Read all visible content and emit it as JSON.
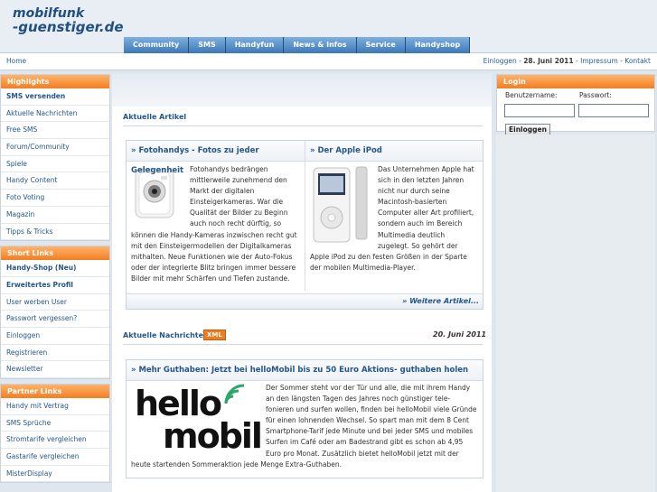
{
  "logo": {
    "line1": "mobilfunk",
    "line2": "-guenstiger.de"
  },
  "nav": [
    "Community",
    "SMS",
    "Handyfun",
    "News & Infos",
    "Service",
    "Handyshop"
  ],
  "breadcrumb": "Home",
  "toplinks": {
    "login": "Einloggen",
    "sep1": " - ",
    "date": "28. Juni 2011",
    "sep2": " - ",
    "impressum": "Impressum",
    "sep3": " - ",
    "kontakt": "Kontakt"
  },
  "sidebar": [
    {
      "title": "Highlights",
      "items": [
        {
          "label": "SMS versenden",
          "bold": true
        },
        {
          "label": "Aktuelle Nachrichten"
        },
        {
          "label": "Free SMS"
        },
        {
          "label": "Forum/Community"
        },
        {
          "label": "Spiele"
        },
        {
          "label": "Handy Content"
        },
        {
          "label": "Foto Voting"
        },
        {
          "label": "Magazin"
        },
        {
          "label": "Tipps & Tricks"
        }
      ]
    },
    {
      "title": "Short Links",
      "items": [
        {
          "label": "Handy-Shop (Neu)",
          "bold": true
        },
        {
          "label": "Erweitertes Profil",
          "bold": true
        },
        {
          "label": "User werben User"
        },
        {
          "label": "Passwort vergessen?"
        },
        {
          "label": "Einloggen"
        },
        {
          "label": "Registrieren"
        },
        {
          "label": "Newsletter"
        }
      ]
    },
    {
      "title": "Partner Links",
      "items": [
        {
          "label": "Handy mit Vertrag"
        },
        {
          "label": "SMS Sprüche"
        },
        {
          "label": "Stromtarife vergleichen"
        },
        {
          "label": "Gastarife vergleichen"
        },
        {
          "label": "MisterDisplay"
        }
      ]
    }
  ],
  "articles": {
    "title": "Aktuelle Artikel",
    "left": {
      "headline": "» Fotohandys - Fotos zu jeder Gelegenheit",
      "text": "Fotohandys bedrängen mittlerweile zunehmend den Markt der digitalen Einsteigerkameras. War die Qualität der Bilder zu Beginn auch noch recht dürftig, so können die Handy-Kameras inzwischen recht gut mit den Einsteigermodellen der Digitalkameras mithalten. Neue Funktionen wie der Auto-Fokus oder der integrierte Blitz bringen immer bessere Bilder mit mehr Schärfen und Tiefen zustande."
    },
    "right": {
      "headline": "» Der Apple iPod",
      "text": "Das Unternehmen Apple hat sich in den letzten Jahren nicht nur durch seine Macintosh-basierten Computer aller Art profiliert, sondern auch im Bereich Multimedia deutlich zugelegt. So gehört der Apple iPod zu den festen Größen in der Sparte der mobilen Multimedia-Player."
    },
    "more": "» Weitere Artikel..."
  },
  "news": {
    "title": "Aktuelle Nachrichten",
    "badge": "XML",
    "date": "20. Juni 2011",
    "headline": "» Mehr Guthaben: Jetzt bei helloMobil bis zu 50 Euro Aktions- guthaben holen",
    "logo_word1": "hello",
    "logo_word2": "mobil",
    "text": "Der Sommer steht vor der Tür und alle, die mit ihrem Handy an den längsten Tagen des Jahres noch günstiger tele- fonieren und surfen wollen, finden bei helloMobil viele Gründe für einen lohnenden Wechsel. So spart man mit dem 8 Cent Smartphone-Tarif jede Minute und bei jeder SMS und mobiles Surfen im Café oder am Badestrand gibt es schon ab 4,95 Euro pro Monat. Zusätzlich bietet helloMobil jetzt mit der heute startenden Sommeraktion jede Menge Extra-Guthaben."
  },
  "login": {
    "title": "Login",
    "user_label": "Benutzername:",
    "pass_label": "Passwort:",
    "button": "Einloggen"
  },
  "colors": {
    "accent_orange": "#f27e22",
    "nav_blue": "#3c78b6",
    "link_blue": "#24568c"
  }
}
